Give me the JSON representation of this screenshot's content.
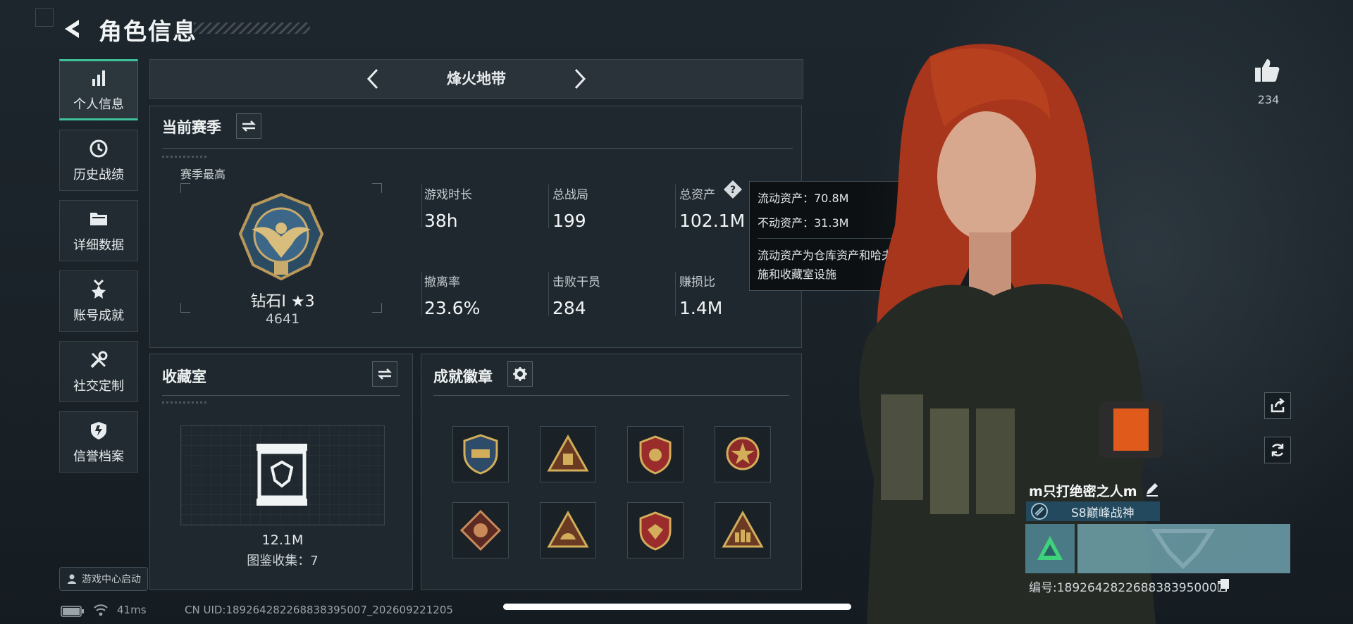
{
  "header": {
    "title": "角色信息"
  },
  "sidebar": {
    "items": [
      {
        "label": "个人信息",
        "active": true
      },
      {
        "label": "历史战绩"
      },
      {
        "label": "详细数据"
      },
      {
        "label": "账号成就"
      },
      {
        "label": "社交定制"
      },
      {
        "label": "信誉档案"
      }
    ],
    "launch_label": "游戏中心启动"
  },
  "mode": {
    "name": "烽火地带"
  },
  "season": {
    "title": "当前赛季",
    "best_label": "赛季最高",
    "rank": "钻石I ★3",
    "score": "4641",
    "stats": [
      {
        "key": "游戏时长",
        "value": "38h"
      },
      {
        "key": "总战局",
        "value": "199"
      },
      {
        "key": "总资产",
        "value": "102.1M"
      },
      {
        "key": "撤离率",
        "value": "23.6%"
      },
      {
        "key": "击败干员",
        "value": "284"
      },
      {
        "key": "赚损比",
        "value": "1.4M"
      }
    ]
  },
  "tooltip": {
    "liquid": "流动资产：70.8M",
    "fixed": "不动资产：31.3M",
    "desc": "流动资产为仓库资产和哈夫币，不动资产为特勤处设施和收藏室设施"
  },
  "collection": {
    "title": "收藏室",
    "value": "12.1M",
    "count": "图鉴收集：7"
  },
  "achievements": {
    "title": "成就徽章"
  },
  "profile": {
    "likes": "234",
    "name": "m只打绝密之人m",
    "season_tag": "S8巅峰战神",
    "uid": "编号:1892642822688383950007"
  },
  "status_bar": {
    "ping": "41ms",
    "uid_line": "CN UID:1892642822688383950​07_202609221205"
  },
  "colors": {
    "accent": "#3fc29a",
    "panel": "#1f282e",
    "tag": "#23495f"
  }
}
